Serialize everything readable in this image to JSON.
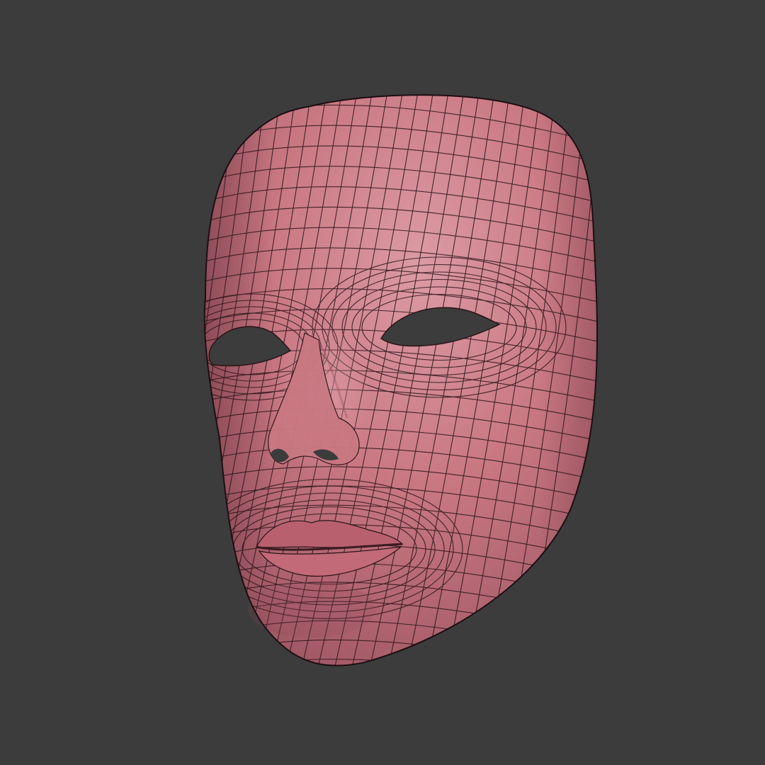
{
  "scene": {
    "background_color": "#3c3c3c",
    "subject": "face-mask-wireframe",
    "mask_base_color": "#c97882",
    "mask_highlight_color": "#dc9ba4",
    "mask_shadow_color": "#8e4a56",
    "wire_color": "#2a1418",
    "eye_hole_color": "#3c3c3c"
  }
}
